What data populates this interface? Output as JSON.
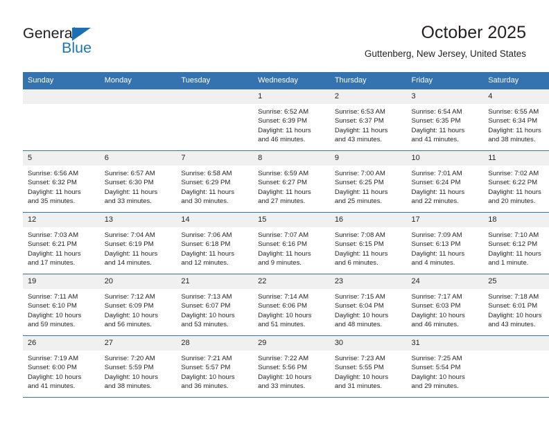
{
  "brand": {
    "name_top": "General",
    "name_bottom": "Blue",
    "accent_color": "#1b75bb",
    "triangle_icon": "triangle-icon"
  },
  "header": {
    "title": "October 2025",
    "location": "Guttenberg, New Jersey, United States",
    "header_bg_color": "#3572b0",
    "daynum_bg_color": "#f0f0f0"
  },
  "weekdays": [
    "Sunday",
    "Monday",
    "Tuesday",
    "Wednesday",
    "Thursday",
    "Friday",
    "Saturday"
  ],
  "weeks": [
    [
      {
        "day": "",
        "lines": []
      },
      {
        "day": "",
        "lines": []
      },
      {
        "day": "",
        "lines": []
      },
      {
        "day": "1",
        "lines": [
          "Sunrise: 6:52 AM",
          "Sunset: 6:39 PM",
          "Daylight: 11 hours",
          "and 46 minutes."
        ]
      },
      {
        "day": "2",
        "lines": [
          "Sunrise: 6:53 AM",
          "Sunset: 6:37 PM",
          "Daylight: 11 hours",
          "and 43 minutes."
        ]
      },
      {
        "day": "3",
        "lines": [
          "Sunrise: 6:54 AM",
          "Sunset: 6:35 PM",
          "Daylight: 11 hours",
          "and 41 minutes."
        ]
      },
      {
        "day": "4",
        "lines": [
          "Sunrise: 6:55 AM",
          "Sunset: 6:34 PM",
          "Daylight: 11 hours",
          "and 38 minutes."
        ]
      }
    ],
    [
      {
        "day": "5",
        "lines": [
          "Sunrise: 6:56 AM",
          "Sunset: 6:32 PM",
          "Daylight: 11 hours",
          "and 35 minutes."
        ]
      },
      {
        "day": "6",
        "lines": [
          "Sunrise: 6:57 AM",
          "Sunset: 6:30 PM",
          "Daylight: 11 hours",
          "and 33 minutes."
        ]
      },
      {
        "day": "7",
        "lines": [
          "Sunrise: 6:58 AM",
          "Sunset: 6:29 PM",
          "Daylight: 11 hours",
          "and 30 minutes."
        ]
      },
      {
        "day": "8",
        "lines": [
          "Sunrise: 6:59 AM",
          "Sunset: 6:27 PM",
          "Daylight: 11 hours",
          "and 27 minutes."
        ]
      },
      {
        "day": "9",
        "lines": [
          "Sunrise: 7:00 AM",
          "Sunset: 6:25 PM",
          "Daylight: 11 hours",
          "and 25 minutes."
        ]
      },
      {
        "day": "10",
        "lines": [
          "Sunrise: 7:01 AM",
          "Sunset: 6:24 PM",
          "Daylight: 11 hours",
          "and 22 minutes."
        ]
      },
      {
        "day": "11",
        "lines": [
          "Sunrise: 7:02 AM",
          "Sunset: 6:22 PM",
          "Daylight: 11 hours",
          "and 20 minutes."
        ]
      }
    ],
    [
      {
        "day": "12",
        "lines": [
          "Sunrise: 7:03 AM",
          "Sunset: 6:21 PM",
          "Daylight: 11 hours",
          "and 17 minutes."
        ]
      },
      {
        "day": "13",
        "lines": [
          "Sunrise: 7:04 AM",
          "Sunset: 6:19 PM",
          "Daylight: 11 hours",
          "and 14 minutes."
        ]
      },
      {
        "day": "14",
        "lines": [
          "Sunrise: 7:06 AM",
          "Sunset: 6:18 PM",
          "Daylight: 11 hours",
          "and 12 minutes."
        ]
      },
      {
        "day": "15",
        "lines": [
          "Sunrise: 7:07 AM",
          "Sunset: 6:16 PM",
          "Daylight: 11 hours",
          "and 9 minutes."
        ]
      },
      {
        "day": "16",
        "lines": [
          "Sunrise: 7:08 AM",
          "Sunset: 6:15 PM",
          "Daylight: 11 hours",
          "and 6 minutes."
        ]
      },
      {
        "day": "17",
        "lines": [
          "Sunrise: 7:09 AM",
          "Sunset: 6:13 PM",
          "Daylight: 11 hours",
          "and 4 minutes."
        ]
      },
      {
        "day": "18",
        "lines": [
          "Sunrise: 7:10 AM",
          "Sunset: 6:12 PM",
          "Daylight: 11 hours",
          "and 1 minute."
        ]
      }
    ],
    [
      {
        "day": "19",
        "lines": [
          "Sunrise: 7:11 AM",
          "Sunset: 6:10 PM",
          "Daylight: 10 hours",
          "and 59 minutes."
        ]
      },
      {
        "day": "20",
        "lines": [
          "Sunrise: 7:12 AM",
          "Sunset: 6:09 PM",
          "Daylight: 10 hours",
          "and 56 minutes."
        ]
      },
      {
        "day": "21",
        "lines": [
          "Sunrise: 7:13 AM",
          "Sunset: 6:07 PM",
          "Daylight: 10 hours",
          "and 53 minutes."
        ]
      },
      {
        "day": "22",
        "lines": [
          "Sunrise: 7:14 AM",
          "Sunset: 6:06 PM",
          "Daylight: 10 hours",
          "and 51 minutes."
        ]
      },
      {
        "day": "23",
        "lines": [
          "Sunrise: 7:15 AM",
          "Sunset: 6:04 PM",
          "Daylight: 10 hours",
          "and 48 minutes."
        ]
      },
      {
        "day": "24",
        "lines": [
          "Sunrise: 7:17 AM",
          "Sunset: 6:03 PM",
          "Daylight: 10 hours",
          "and 46 minutes."
        ]
      },
      {
        "day": "25",
        "lines": [
          "Sunrise: 7:18 AM",
          "Sunset: 6:01 PM",
          "Daylight: 10 hours",
          "and 43 minutes."
        ]
      }
    ],
    [
      {
        "day": "26",
        "lines": [
          "Sunrise: 7:19 AM",
          "Sunset: 6:00 PM",
          "Daylight: 10 hours",
          "and 41 minutes."
        ]
      },
      {
        "day": "27",
        "lines": [
          "Sunrise: 7:20 AM",
          "Sunset: 5:59 PM",
          "Daylight: 10 hours",
          "and 38 minutes."
        ]
      },
      {
        "day": "28",
        "lines": [
          "Sunrise: 7:21 AM",
          "Sunset: 5:57 PM",
          "Daylight: 10 hours",
          "and 36 minutes."
        ]
      },
      {
        "day": "29",
        "lines": [
          "Sunrise: 7:22 AM",
          "Sunset: 5:56 PM",
          "Daylight: 10 hours",
          "and 33 minutes."
        ]
      },
      {
        "day": "30",
        "lines": [
          "Sunrise: 7:23 AM",
          "Sunset: 5:55 PM",
          "Daylight: 10 hours",
          "and 31 minutes."
        ]
      },
      {
        "day": "31",
        "lines": [
          "Sunrise: 7:25 AM",
          "Sunset: 5:54 PM",
          "Daylight: 10 hours",
          "and 29 minutes."
        ]
      },
      {
        "day": "",
        "lines": []
      }
    ]
  ]
}
